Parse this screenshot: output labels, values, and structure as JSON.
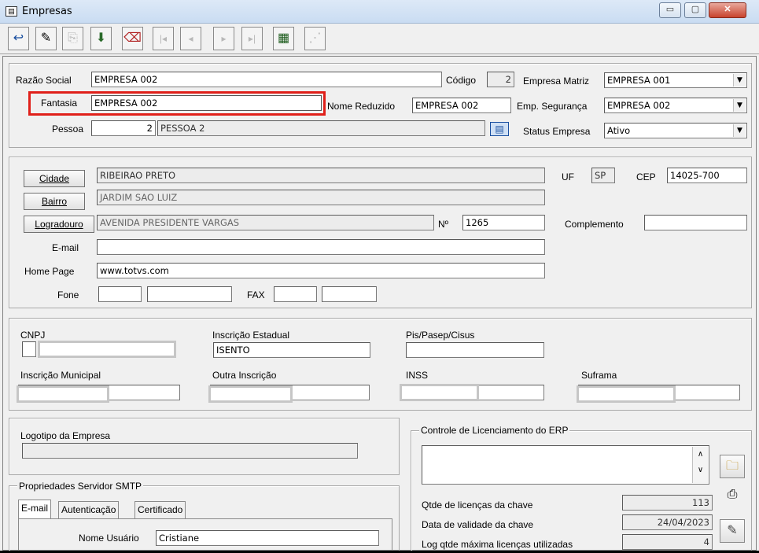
{
  "window": {
    "title": "Empresas",
    "minimize": "▭",
    "maximize": "▢",
    "close": "✕"
  },
  "toolbar": {
    "buttons": [
      {
        "name": "exit",
        "glyph": "↩"
      },
      {
        "name": "edit",
        "glyph": "✎"
      },
      {
        "name": "clone",
        "glyph": "⎘"
      },
      {
        "name": "save",
        "glyph": "⬇"
      },
      {
        "name": "delete",
        "glyph": "⌫"
      },
      {
        "name": "first",
        "glyph": "|◂"
      },
      {
        "name": "prev",
        "glyph": "◂"
      },
      {
        "name": "next",
        "glyph": "▸"
      },
      {
        "name": "last",
        "glyph": "▸|"
      },
      {
        "name": "grid",
        "glyph": "▦"
      },
      {
        "name": "filter",
        "glyph": "⋰"
      }
    ]
  },
  "company": {
    "razao_social_label": "Razão Social",
    "razao_social_value": "EMPRESA 002",
    "codigo_label": "Código",
    "codigo_value": "2",
    "empresa_matriz_label": "Empresa Matriz",
    "empresa_matriz_value": "EMPRESA 001",
    "fantasia_label": "Fantasia",
    "fantasia_value": "EMPRESA 002",
    "nome_reduzido_label": "Nome Reduzido",
    "nome_reduzido_value": "EMPRESA 002",
    "emp_seguranca_label": "Emp. Segurança",
    "emp_seguranca_value": "EMPRESA 002",
    "pessoa_label": "Pessoa",
    "pessoa_code": "2",
    "pessoa_name": "PESSOA 2",
    "status_label": "Status Empresa",
    "status_value": "Ativo",
    "highlight_color": "#e0201a"
  },
  "address": {
    "cidade_button": "Cidade",
    "cidade_value": "RIBEIRAO PRETO",
    "uf_label": "UF",
    "uf_value": "SP",
    "cep_label": "CEP",
    "cep_value": "14025-700",
    "bairro_button": "Bairro",
    "bairro_value": "JARDIM SAO LUIZ",
    "logradouro_button": "Logradouro",
    "logradouro_value": "AVENIDA PRESIDENTE VARGAS",
    "numero_label": "Nº",
    "numero_value": "1265",
    "complemento_label": "Complemento",
    "complemento_value": "",
    "email_label": "E-mail",
    "email_value": "",
    "homepage_label": "Home Page",
    "homepage_value": "www.totvs.com",
    "fone_label": "Fone",
    "fax_label": "FAX"
  },
  "fiscal": {
    "cnpj_label": "CNPJ",
    "ie_label": "Inscrição Estadual",
    "ie_value": "ISENTO",
    "pis_label": "Pis/Pasep/Cisus",
    "im_label": "Inscrição Municipal",
    "outra_label": "Outra Inscrição",
    "inss_label": "INSS",
    "suframa_label": "Suframa"
  },
  "logo": {
    "label": "Logotipo da Empresa"
  },
  "smtp": {
    "legend": "Propriedades Servidor SMTP",
    "tabs": [
      "E-mail",
      "Autenticação",
      "Certificado"
    ],
    "usuario_label": "Nome Usuário",
    "usuario_value": "Cristiane"
  },
  "license": {
    "legend": "Controle de Licenciamento do ERP",
    "qtde_label": "Qtde de licenças da chave",
    "qtde_value": "113",
    "validade_label": "Data de validade da chave",
    "validade_value": "24/04/2023",
    "log_label": "Log qtde máxima licenças utilizadas",
    "log_value": "4"
  }
}
